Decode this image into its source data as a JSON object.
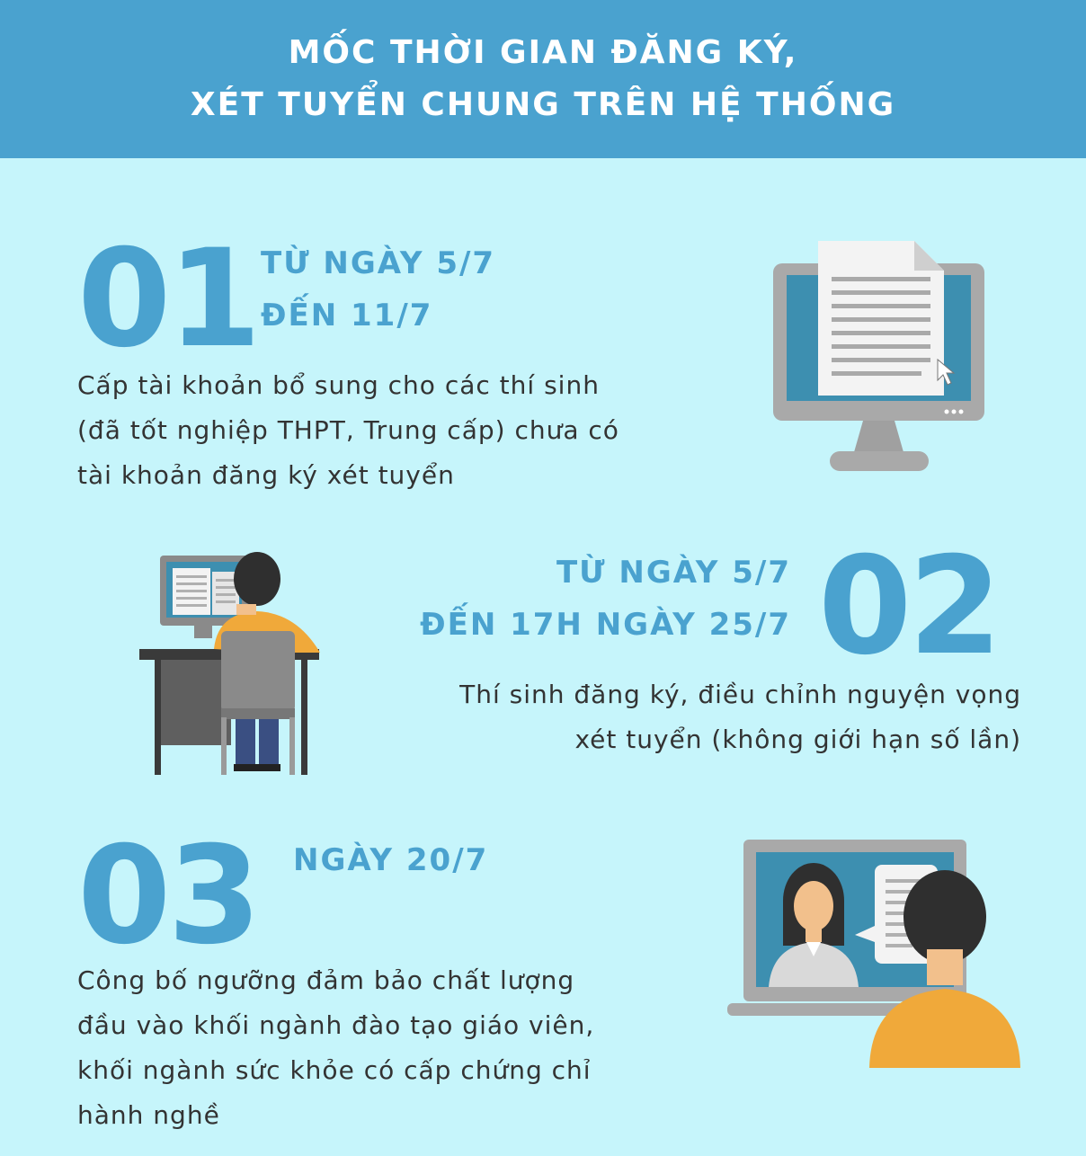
{
  "header": {
    "line1": "MỐC THỜI GIAN ĐĂNG KÝ,",
    "line2": "XÉT TUYỂN CHUNG TRÊN HỆ THỐNG"
  },
  "steps": [
    {
      "number": "01",
      "date_lines": [
        "TỪ NGÀY 5/7",
        "ĐẾN 11/7"
      ],
      "desc_lines": [
        "Cấp tài khoản bổ sung cho các thí sinh",
        "(đã tốt nghiệp THPT, Trung cấp) chưa có",
        "tài khoản đăng ký xét tuyển"
      ],
      "illustration_icon": "computer-document-icon"
    },
    {
      "number": "02",
      "date_lines": [
        "TỪ NGÀY 5/7",
        "ĐẾN 17H NGÀY 25/7"
      ],
      "desc_lines": [
        "Thí sinh đăng ký, điều chỉnh nguyện vọng",
        "xét tuyển (không giới hạn số lần)"
      ],
      "illustration_icon": "student-at-desk-icon"
    },
    {
      "number": "03",
      "date_lines": [
        "NGÀY 20/7"
      ],
      "desc_lines": [
        "Công bố ngưỡng đảm bảo chất lượng",
        "đầu vào khối ngành đào tạo giáo viên,",
        "khối ngành sức khỏe có cấp chứng chỉ",
        "hành nghề"
      ],
      "illustration_icon": "video-call-laptop-icon"
    }
  ],
  "colors": {
    "header_bg": "#4aa2cf",
    "page_bg": "#c6f5fb",
    "accent": "#4aa2cf",
    "text": "#333333",
    "orange": "#f0a93a"
  }
}
